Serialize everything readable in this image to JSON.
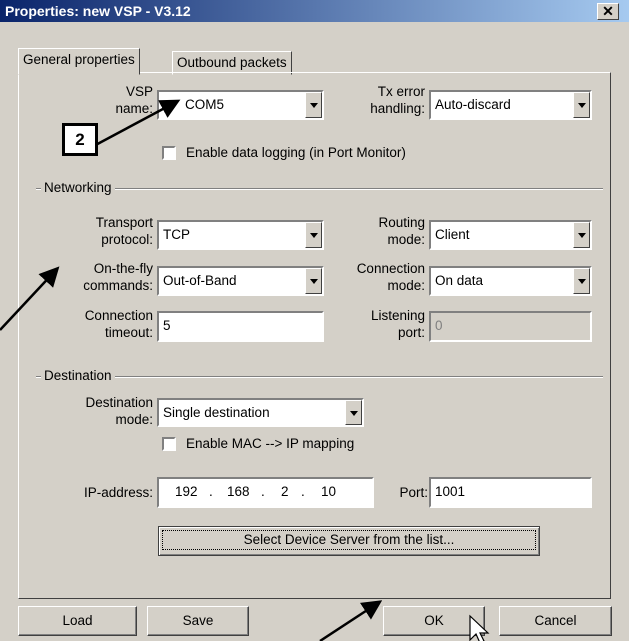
{
  "window": {
    "title": "Properties: new VSP - V3.12",
    "close_glyph": "✕"
  },
  "tabs": [
    {
      "label": "General properties",
      "active": true
    },
    {
      "label": "Outbound packets",
      "active": false
    }
  ],
  "general": {
    "vsp_name": {
      "label_line1": "VSP",
      "label_line2": "name:",
      "value": "COM5"
    },
    "tx_error": {
      "label_line1": "Tx error",
      "label_line2": "handling:",
      "value": "Auto-discard"
    },
    "data_logging": {
      "label": "Enable data logging (in Port Monitor)",
      "checked": false
    }
  },
  "networking": {
    "group_title": "Networking",
    "transport": {
      "label_line1": "Transport",
      "label_line2": "protocol:",
      "value": "TCP"
    },
    "routing": {
      "label_line1": "Routing",
      "label_line2": "mode:",
      "value": "Client"
    },
    "onthefly": {
      "label_line1": "On-the-fly",
      "label_line2": "commands:",
      "value": "Out-of-Band"
    },
    "connection_mode": {
      "label_line1": "Connection",
      "label_line2": "mode:",
      "value": "On data"
    },
    "connection_timeout": {
      "label_line1": "Connection",
      "label_line2": "timeout:",
      "value": "5"
    },
    "listening_port": {
      "label_line1": "Listening",
      "label_line2": "port:",
      "value": "0"
    }
  },
  "destination": {
    "group_title": "Destination",
    "mode": {
      "label_line1": "Destination",
      "label_line2": "mode:",
      "value": "Single destination"
    },
    "mac_mapping": {
      "label": "Enable MAC --> IP mapping",
      "checked": false
    },
    "ip": {
      "label": "IP-address:",
      "octets": [
        "192",
        "168",
        "2",
        "10"
      ],
      "dot": "."
    },
    "port": {
      "label": "Port:",
      "value": "1001"
    },
    "select_button": "Select Device Server from the list..."
  },
  "buttons": {
    "load": "Load",
    "save": "Save",
    "ok": "OK",
    "cancel": "Cancel"
  },
  "annotation": {
    "callout": "2"
  }
}
